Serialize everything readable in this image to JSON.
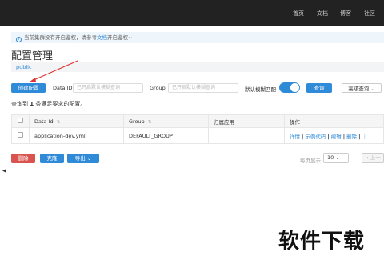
{
  "topnav": [
    "首页",
    "文档",
    "博客",
    "社区"
  ],
  "notice": {
    "text": "当前集群没有开启鉴权，请参考",
    "link": "文档",
    "suffix": "开启鉴权~"
  },
  "page_title": "配置管理",
  "namespace": "public",
  "toolbar": {
    "create_label": "创建配置",
    "dataid_label": "Data ID",
    "dataid_placeholder": "已开启默认模糊查询",
    "group_label": "Group",
    "group_placeholder": "已开启默认模糊查询",
    "fuzzy_label": "默认模糊匹配",
    "fuzzy_on": true,
    "search_label": "查询",
    "advanced_label": "高级查询"
  },
  "summary": {
    "prefix": "查询到",
    "count": "1",
    "suffix": "条满足要求的配置。"
  },
  "table": {
    "headers": [
      "Data Id",
      "Group",
      "归属应用",
      "操作"
    ],
    "rows": [
      {
        "dataid": "application-dev.yml",
        "group": "DEFAULT_GROUP",
        "app": ""
      }
    ],
    "ops": [
      "详情",
      "示例代码",
      "编辑",
      "删除"
    ],
    "more": "⋮"
  },
  "footer": {
    "delete_label": "删除",
    "clone_label": "克隆",
    "export_label": "导出",
    "page_size_label": "每页显示:",
    "page_size": "10",
    "prev_label": "上一"
  },
  "watermark": "软件下载",
  "colors": {
    "accent": "#2f8ad8",
    "danger": "#d9534f",
    "topbar": "#222222"
  }
}
